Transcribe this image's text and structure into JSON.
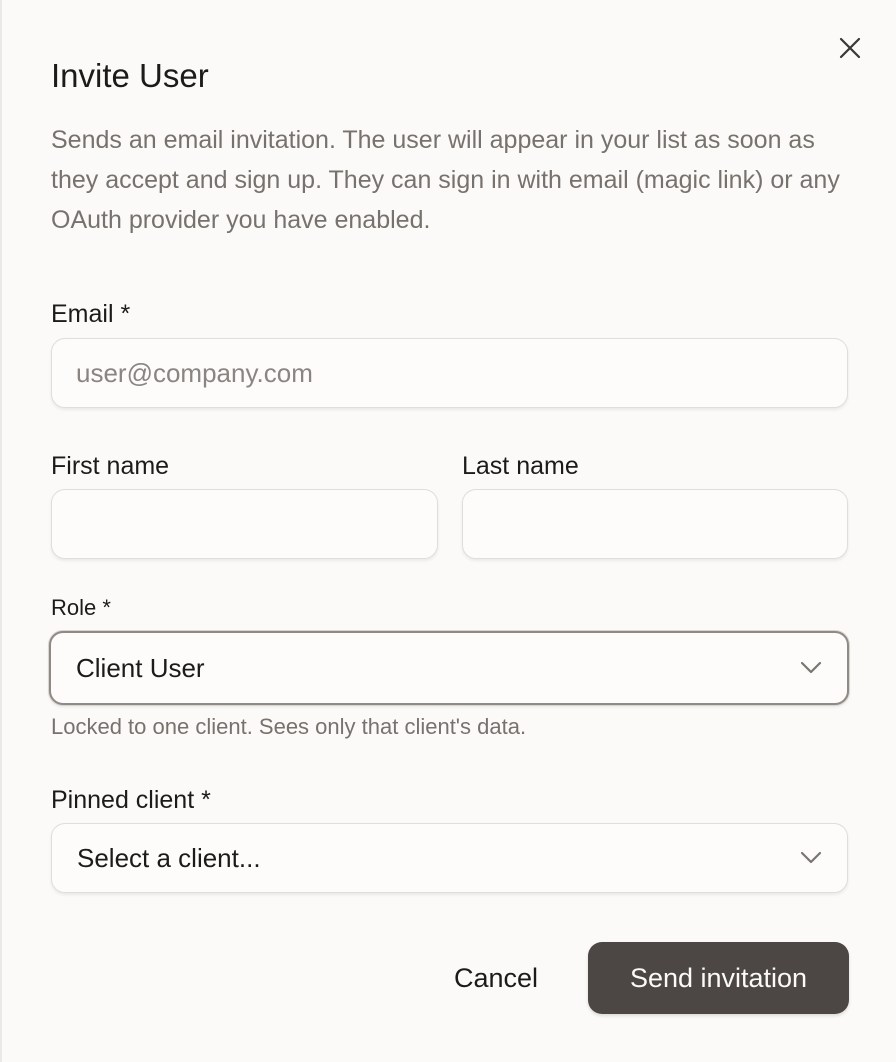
{
  "dialog": {
    "title": "Invite User",
    "description": "Sends an email invitation. The user will appear in your list as soon as they accept and sign up. They can sign in with email (magic link) or any OAuth provider you have enabled.",
    "close_icon": "close-icon"
  },
  "form": {
    "email": {
      "label": "Email *",
      "value": "",
      "placeholder": "user@company.com"
    },
    "first_name": {
      "label": "First name",
      "value": "",
      "placeholder": ""
    },
    "last_name": {
      "label": "Last name",
      "value": "",
      "placeholder": ""
    },
    "role": {
      "label": "Role *",
      "selected": "Client User",
      "hint": "Locked to one client. Sees only that client's data.",
      "icon": "chevron-down-icon"
    },
    "pinned_client": {
      "label": "Pinned client *",
      "selected": "Select a client...",
      "icon": "chevron-down-icon"
    }
  },
  "actions": {
    "cancel_label": "Cancel",
    "send_label": "Send invitation"
  },
  "colors": {
    "primary_button": "#4c4744",
    "background": "#fbfaf8",
    "muted_text": "#77726d"
  }
}
